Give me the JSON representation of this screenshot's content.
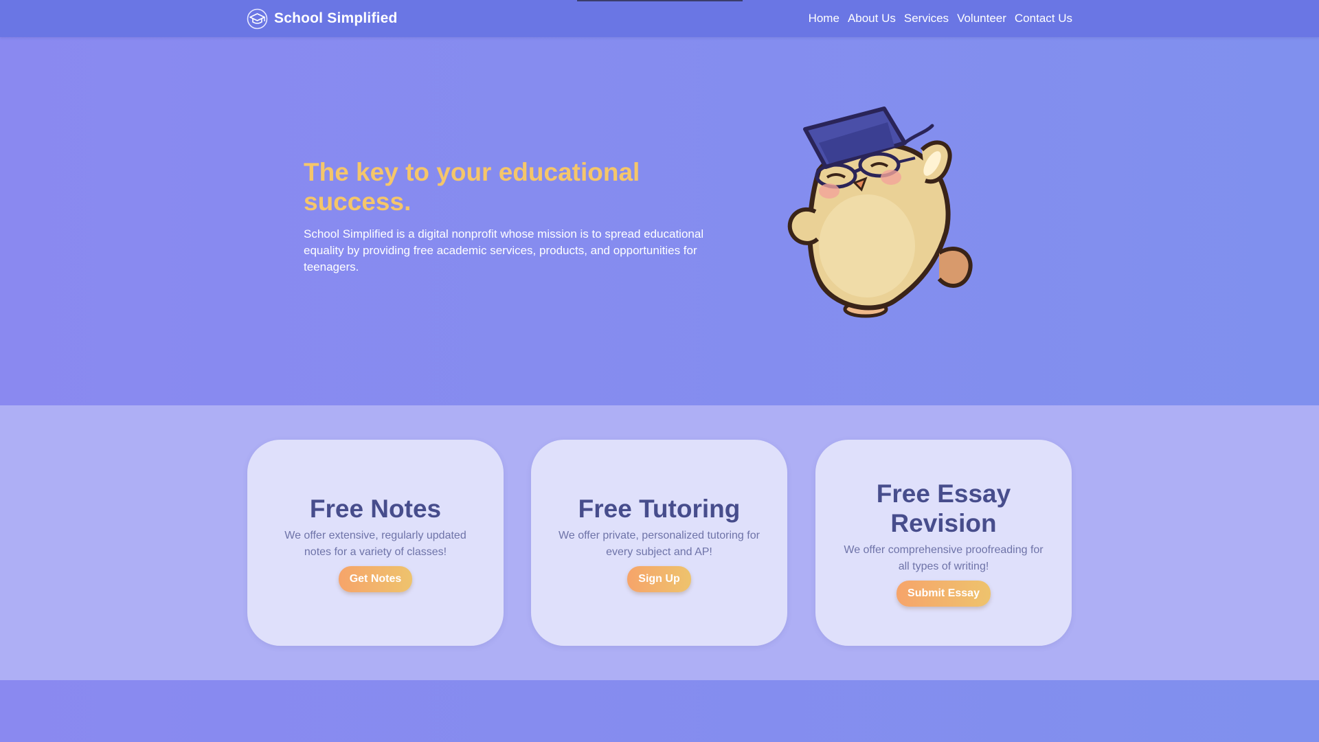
{
  "nav": {
    "brand": "School Simplified",
    "links": [
      "Home",
      "About Us",
      "Services",
      "Volunteer",
      "Contact Us"
    ]
  },
  "hero": {
    "title": "The key to your educational success.",
    "description": "School Simplified is a digital nonprofit whose mission is to spread educational equality by providing free academic services, products, and opportunities for teenagers."
  },
  "cards": [
    {
      "title": "Free Notes",
      "description": "We offer extensive, regularly updated notes for a variety of classes!",
      "button": "Get Notes"
    },
    {
      "title": "Free Tutoring",
      "description": "We offer private, personalized tutoring for every subject and AP!",
      "button": "Sign Up"
    },
    {
      "title": "Free Essay Revision",
      "description": "We offer comprehensive proofreading for all types of writing!",
      "button": "Submit Essay"
    }
  ],
  "colors": {
    "nav_bg": "#6a76e4",
    "hero_title": "#f5c66a",
    "card_bg": "#dfe0fb",
    "card_title": "#474d8c",
    "button_gradient_start": "#f6a46a",
    "button_gradient_end": "#eec36d"
  },
  "icons": {
    "brand": "graduation-cap-icon",
    "mascot": "chick-mascot-with-graduation-cap"
  }
}
